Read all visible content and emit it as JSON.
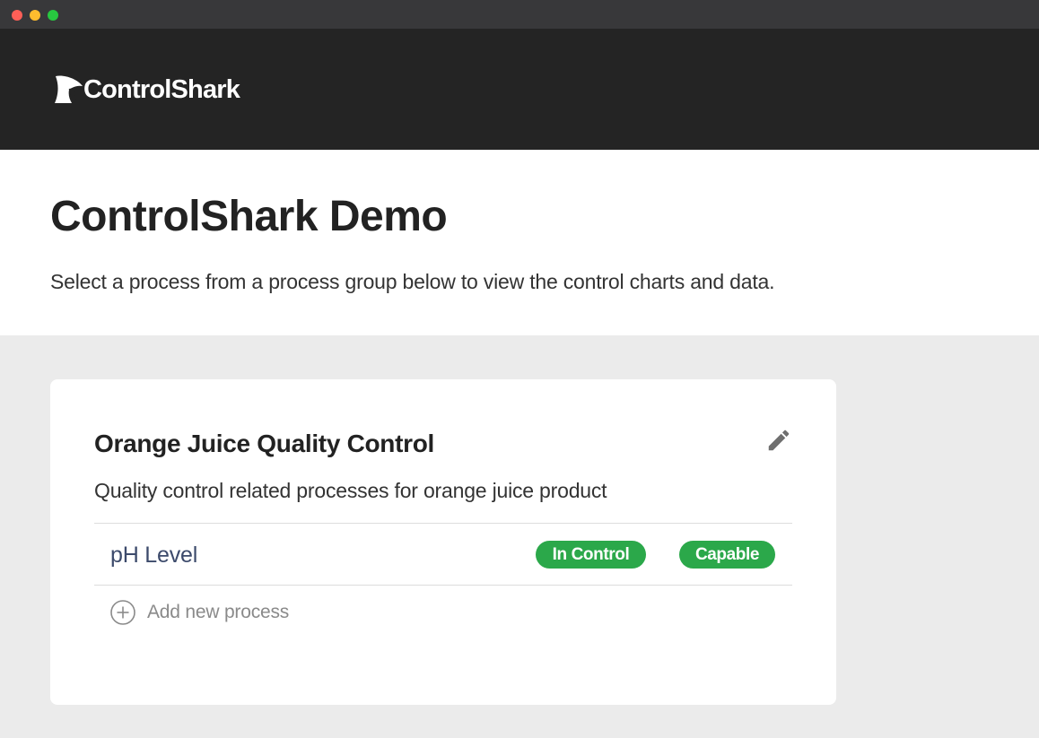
{
  "window": {
    "controls": [
      "close",
      "minimize",
      "maximize"
    ]
  },
  "header": {
    "logo_text": "ControlShark",
    "logo_icon": "shark-fin-icon"
  },
  "hero": {
    "title": "ControlShark Demo",
    "subtitle": "Select a process from a process group below to view the control charts and data."
  },
  "process_group": {
    "title": "Orange Juice Quality Control",
    "description": "Quality control related processes for orange juice product",
    "edit_icon": "pencil-icon",
    "processes": [
      {
        "name": "pH Level",
        "badges": [
          "In Control",
          "Capable"
        ]
      }
    ],
    "add_label": "Add new process",
    "add_icon": "plus-circle-icon"
  },
  "colors": {
    "header_bg": "#242424",
    "badge_green": "#2ba84a",
    "page_bg": "#ebebeb",
    "process_name": "#3c4a6b"
  }
}
